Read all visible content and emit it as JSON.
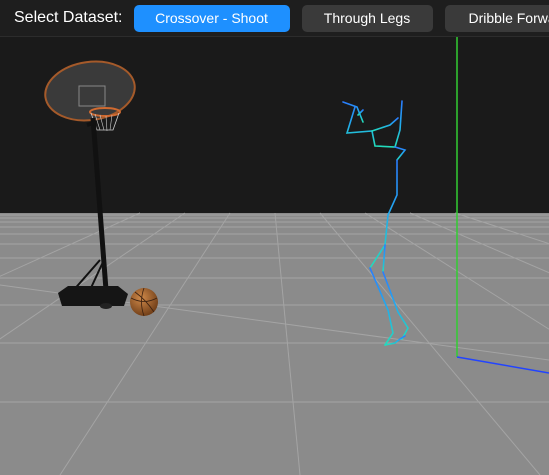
{
  "toolbar": {
    "label": "Select Dataset:",
    "buttons": [
      {
        "label": "Crossover - Shoot",
        "active": true
      },
      {
        "label": "Through Legs",
        "active": false
      },
      {
        "label": "Dribble Forward",
        "active": false
      }
    ]
  },
  "colors": {
    "accent": "#1e90ff",
    "button_bg": "#3a3a3a",
    "sky": "#1a1a1a",
    "ground": "#8a8a8a",
    "y_axis": "#33cc33",
    "x_axis": "#2244ff",
    "skeleton_top": "#2288ff",
    "skeleton_bottom": "#22ddbb"
  },
  "scene": {
    "objects": [
      "basketball-hoop",
      "basketball",
      "pose-skeleton",
      "ground-grid",
      "axis-helper"
    ]
  }
}
